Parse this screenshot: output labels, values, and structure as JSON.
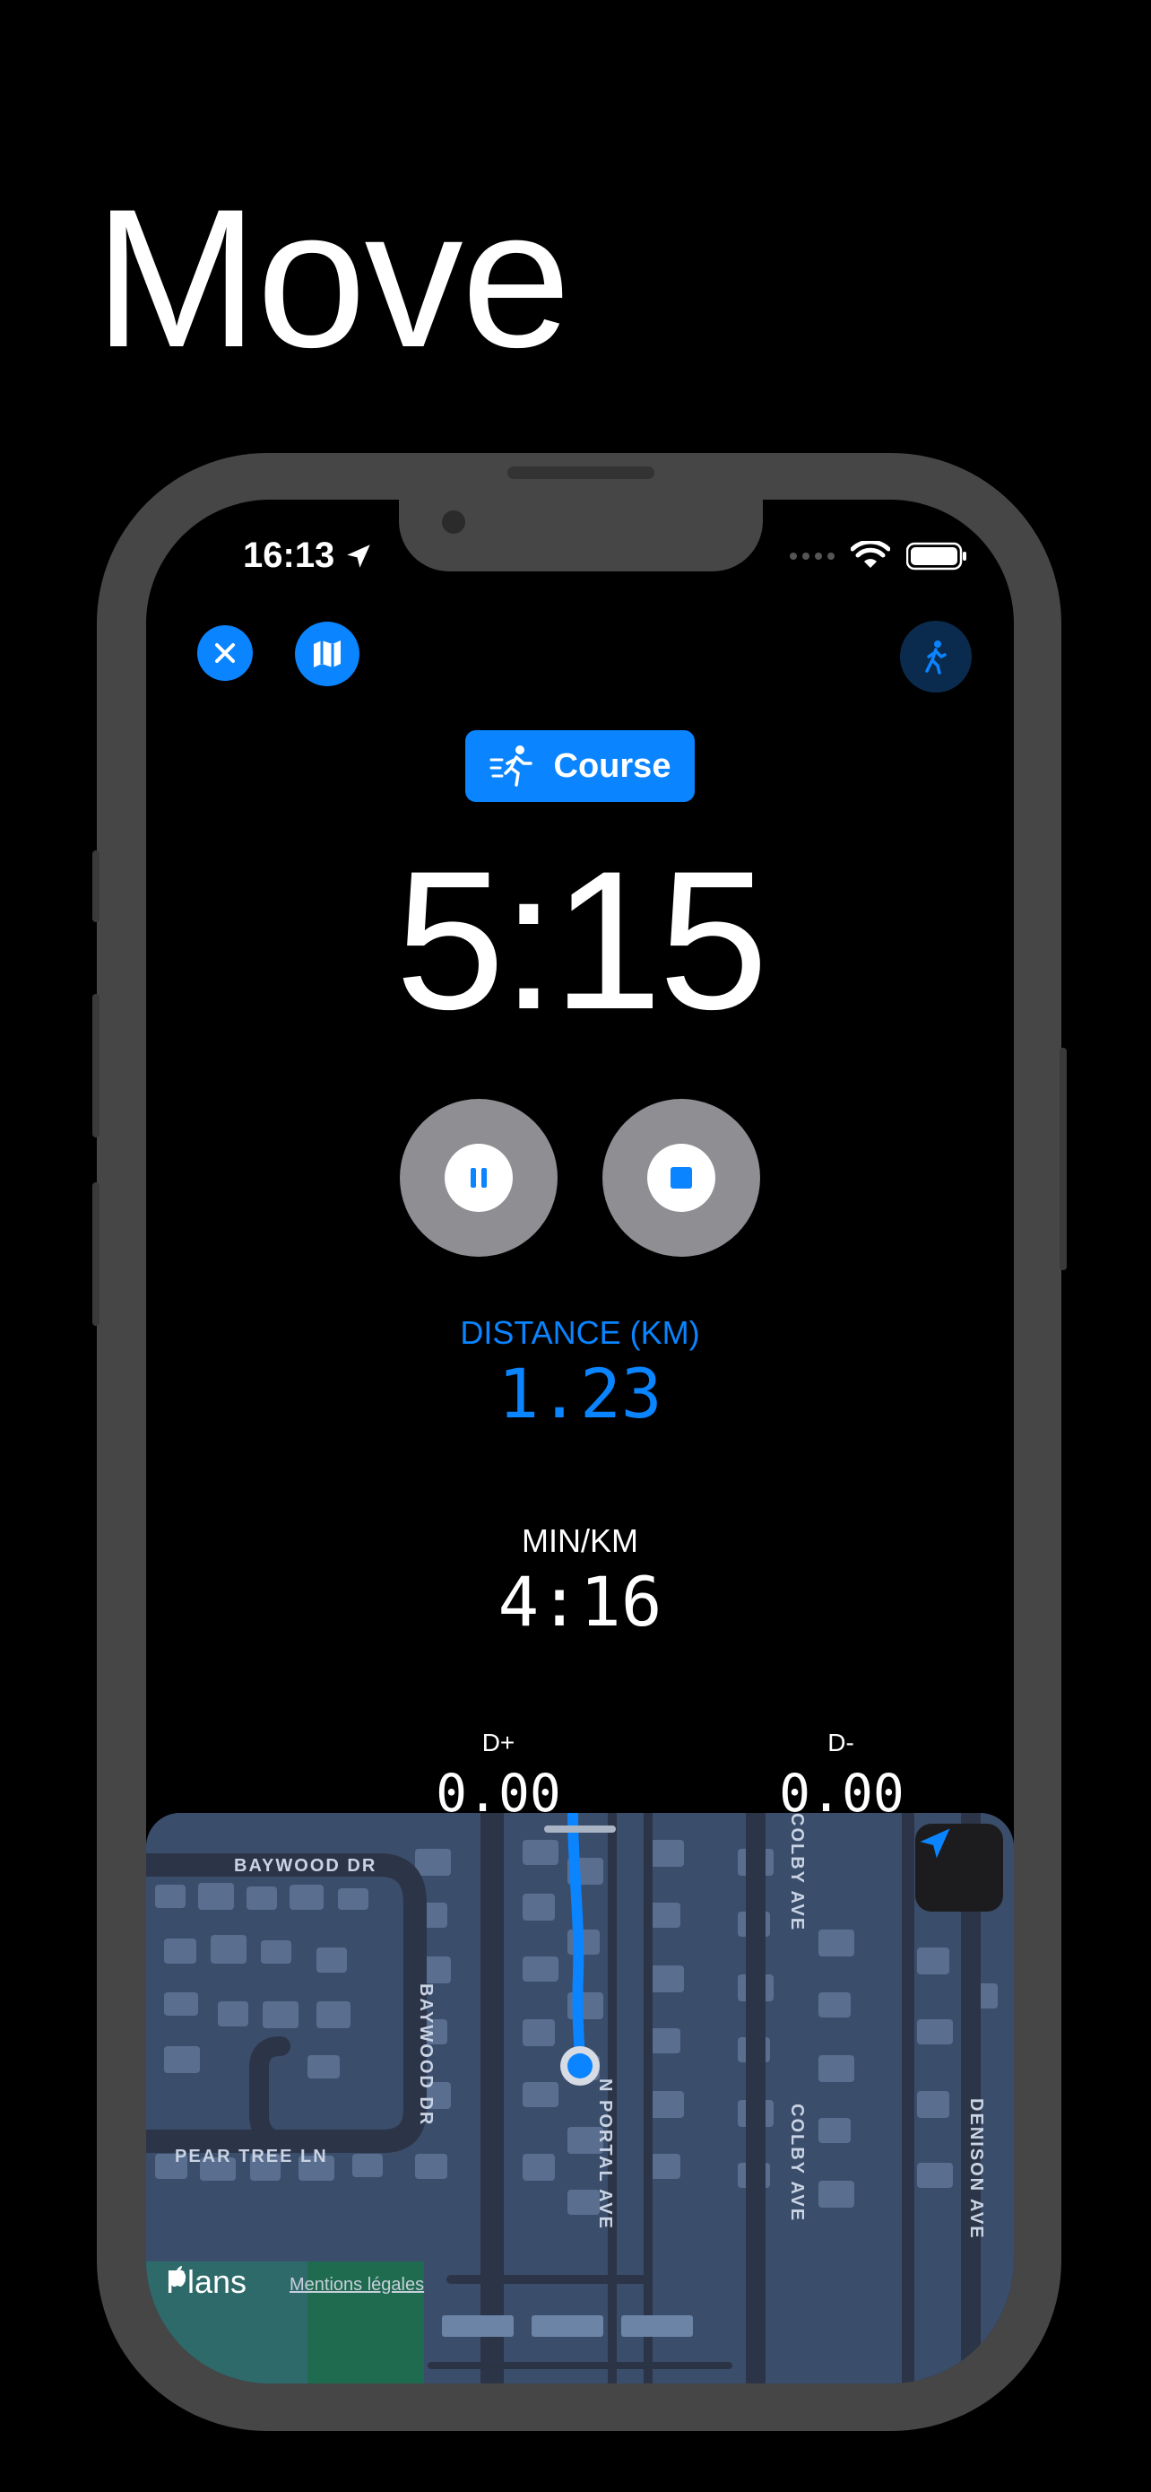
{
  "promo": {
    "title": "Move"
  },
  "status": {
    "time": "16:13"
  },
  "workout": {
    "mode_label": "Course",
    "elapsed": "5:15",
    "distance_label": "DISTANCE (KM)",
    "distance_value": "1.23",
    "pace_label": "MIN/KM",
    "pace_value": "4:16",
    "elev_gain_label": "D+",
    "elev_gain_value": "0.00",
    "elev_loss_label": "D-",
    "elev_loss_value": "0.00"
  },
  "map": {
    "streets": [
      "BAYWOOD DR",
      "BAYWOOD DR",
      "PEAR TREE LN",
      "N PORTAL AVE",
      "COLBY AVE",
      "COLBY AVE",
      "DENISON AVE"
    ],
    "brand": "Plans",
    "legal_link": "Mentions légales"
  },
  "colors": {
    "accent": "#0a84ff",
    "control": "#8e8e93",
    "map_bg": "#3a4d6b"
  }
}
